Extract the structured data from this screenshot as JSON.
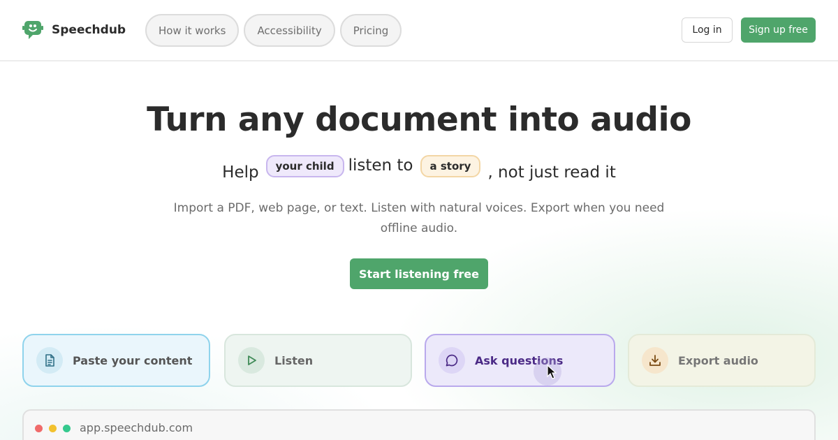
{
  "brand": {
    "name": "Speechdub",
    "accent": "#4fa56b"
  },
  "nav": {
    "items": [
      {
        "label": "How it works"
      },
      {
        "label": "Accessibility"
      },
      {
        "label": "Pricing"
      }
    ],
    "login_label": "Log in",
    "signup_label": "Sign up free"
  },
  "hero": {
    "title": "Turn any document into audio",
    "sub_prefix": "Help",
    "chip_who": "your child",
    "sub_middle": "listen to",
    "chip_what": "a story",
    "sub_suffix": ", not just read it",
    "description": "Import a PDF, web page, or text. Listen with natural voices. Export when you need offline audio.",
    "cta_label": "Start listening free"
  },
  "features": [
    {
      "label": "Paste your content",
      "icon": "document-icon"
    },
    {
      "label": "Listen",
      "icon": "play-icon"
    },
    {
      "label": "Ask questions",
      "icon": "chat-bubble-icon"
    },
    {
      "label": "Export audio",
      "icon": "download-icon"
    }
  ],
  "preview": {
    "url": "app.speechdub.com"
  }
}
